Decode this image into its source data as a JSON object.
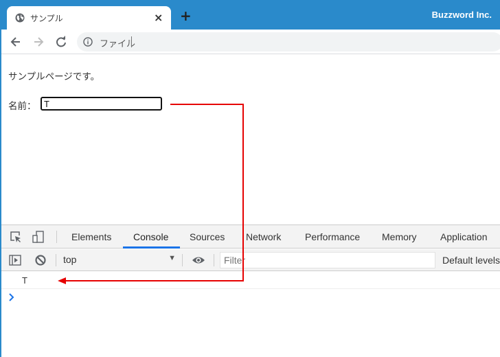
{
  "browser": {
    "tab_title": "サンプル",
    "tab_close": "×",
    "new_tab": "+",
    "brand": "Buzzword Inc.",
    "omnibox_text": "ファイル",
    "icons": {
      "tab": "globe-icon",
      "back": "arrow-left-icon",
      "forward": "arrow-right-icon",
      "reload": "reload-icon",
      "site_info": "info-icon"
    }
  },
  "page": {
    "text": "サンプルページです。",
    "name_label": "名前：",
    "name_value": "T"
  },
  "devtools": {
    "tabs": [
      "Elements",
      "Console",
      "Sources",
      "Network",
      "Performance",
      "Memory",
      "Application"
    ],
    "active_tab": "Console",
    "context": "top",
    "filter_placeholder": "Filter",
    "levels": "Default levels",
    "log_output": "T",
    "icons": {
      "inspect": "inspect-element-icon",
      "device": "device-toolbar-icon",
      "sidebar": "show-sidebar-icon",
      "clear": "clear-console-icon",
      "eye": "live-expression-icon",
      "prompt": "chevron-right-icon"
    }
  },
  "annotation": {
    "color": "#e60000",
    "description": "arrow from input value to console output"
  },
  "colors": {
    "titlebar": "#2a8acb",
    "active_tab_underline": "#1a73e8"
  }
}
